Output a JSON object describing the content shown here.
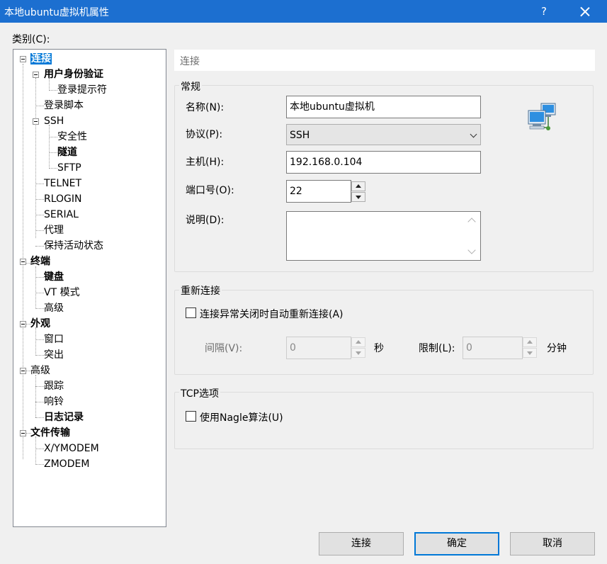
{
  "window": {
    "title": "本地ubuntu虚拟机属性",
    "help_label": "?"
  },
  "category_label": "类别(C):",
  "tree": {
    "connection": "连接",
    "user_auth": "用户身份验证",
    "login_prompt": "登录提示符",
    "login_script": "登录脚本",
    "ssh": "SSH",
    "security": "安全性",
    "tunnel": "隧道",
    "sftp": "SFTP",
    "telnet": "TELNET",
    "rlogin": "RLOGIN",
    "serial": "SERIAL",
    "proxy": "代理",
    "keepalive": "保持活动状态",
    "terminal": "终端",
    "keyboard": "键盘",
    "vt_mode": "VT 模式",
    "terminal_advanced": "高级",
    "appearance": "外观",
    "window_item": "窗口",
    "highlight": "突出",
    "advanced": "高级",
    "trace": "跟踪",
    "bell": "响铃",
    "log": "日志记录",
    "file_transfer": "文件传输",
    "xymodem": "X/YMODEM",
    "zmodem": "ZMODEM"
  },
  "header": "连接",
  "general": {
    "title": "常规",
    "name_label": "名称(N):",
    "name_value": "本地ubuntu虚拟机",
    "protocol_label": "协议(P):",
    "protocol_value": "SSH",
    "host_label": "主机(H):",
    "host_value": "192.168.0.104",
    "port_label": "端口号(O):",
    "port_value": "22",
    "desc_label": "说明(D):"
  },
  "reconnect": {
    "title": "重新连接",
    "checkbox_label": "连接异常关闭时自动重新连接(A)",
    "interval_label": "间隔(V):",
    "interval_value": "0",
    "seconds": "秒",
    "limit_label": "限制(L):",
    "limit_value": "0",
    "minutes": "分钟"
  },
  "tcp": {
    "title": "TCP选项",
    "nagle_label": "使用Nagle算法(U)"
  },
  "buttons": {
    "connect": "连接",
    "ok": "确定",
    "cancel": "取消"
  },
  "colors": {
    "titlebar": "#1c6fd0",
    "selection": "#0078d7"
  }
}
